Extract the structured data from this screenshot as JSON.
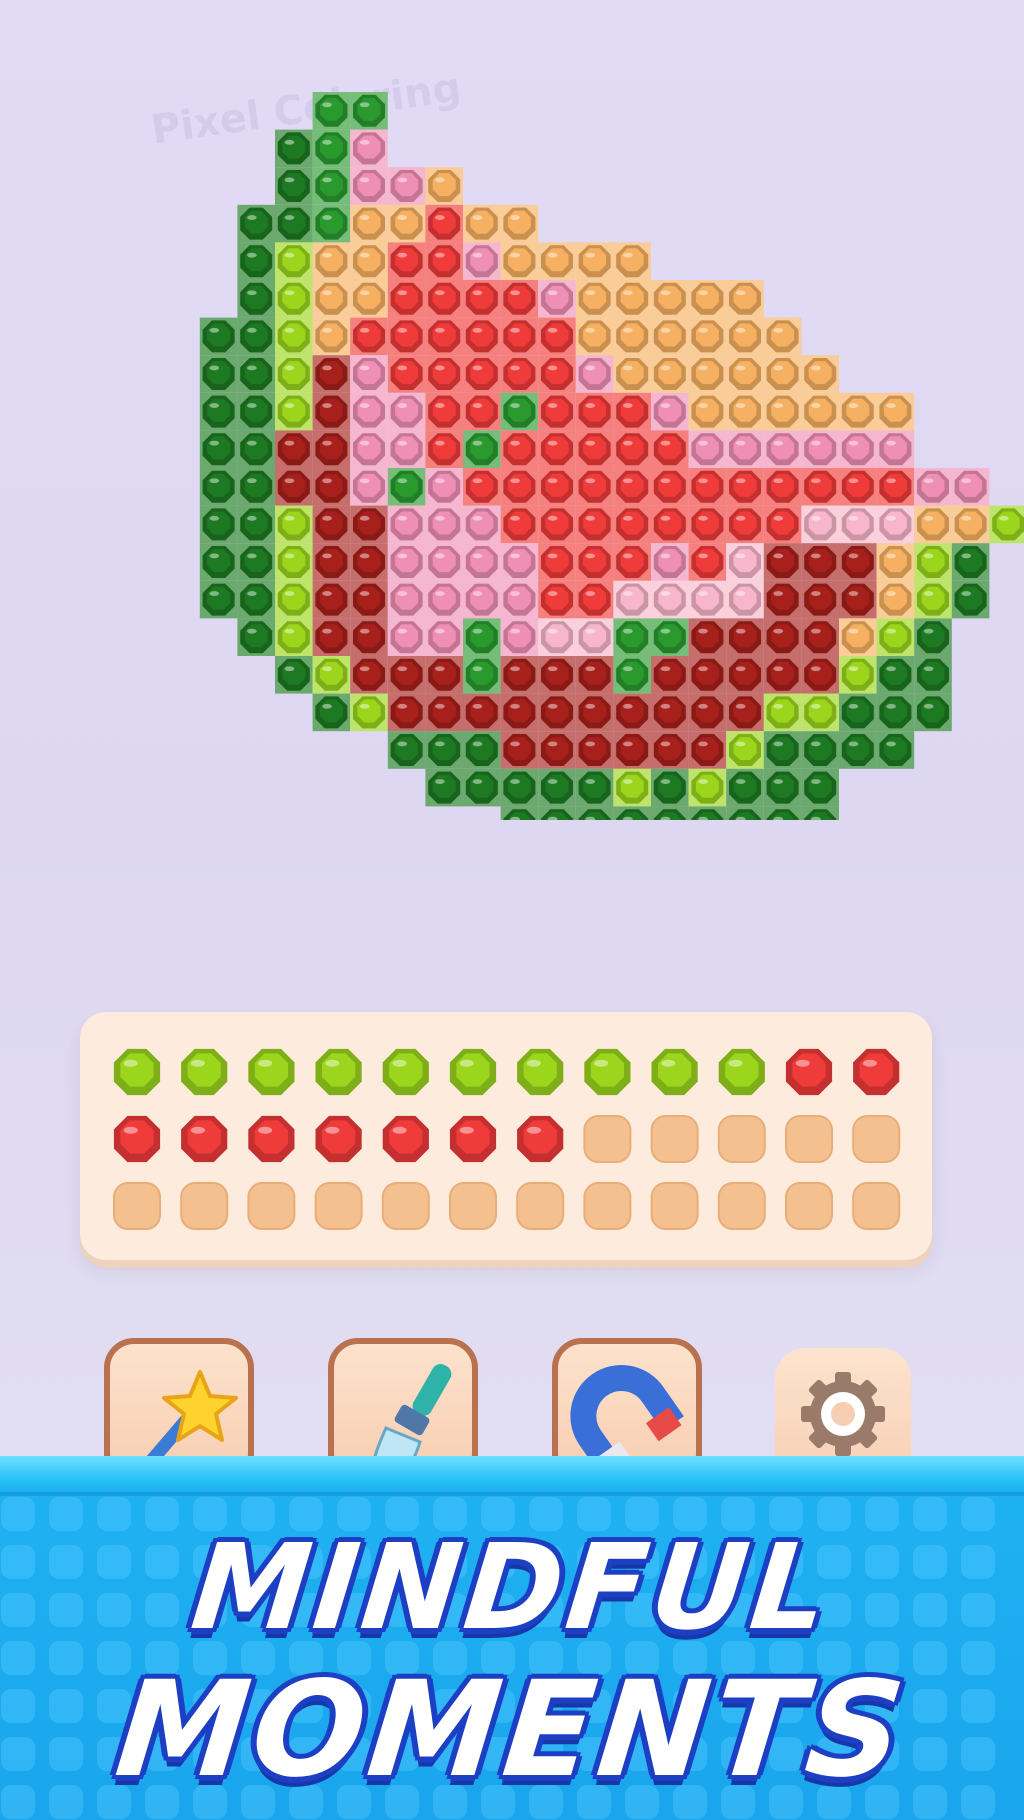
{
  "watermark": "Pixel Coloring",
  "board": {
    "rows": [
      "......kk.................",
      ".....Kkp.................",
      ".....Kkppo...............",
      "....KKkooRoo.............",
      "....KlooRRpoooo..........",
      "....KlooRRRRpooooo.......",
      "...KKloRRRRRRoooooo......",
      "...KKlDpRRRRRpoooooo.....",
      "...KKlDppRRkRRRpoooooo...",
      "...KKDDppRkRRRRRpppppp...",
      "...KKDDpkpRRRRRRRRRRRRpp.",
      "...KKlDDpppRRRRRRRRPPPool",
      "...KKlDDppppRRRpRPDDDolK",
      "...KKlDDppppRRPPPPDDDolK",
      "....KlDDppkpPPkkDDDDolK.",
      ".....KlDDDkDDDkDDDDDlKK.",
      "......KlDDDDDDDDDDllKKK.",
      "........KKKDDDDDDlKKKK..",
      ".........KKKKKlKlKKK....",
      "...........KKKKKKKKK....",
      "........................"
    ],
    "legend": {
      "K": "dark-green",
      "k": "green",
      "l": "lime",
      "p": "pink",
      "P": "light-pink",
      "o": "orange",
      "R": "red",
      "D": "dark-red",
      "n": "navy"
    }
  },
  "tray": {
    "rows": [
      [
        "lime",
        "lime",
        "lime",
        "lime",
        "lime",
        "lime",
        "lime",
        "lime",
        "lime",
        "lime",
        "red",
        "red"
      ],
      [
        "red",
        "red",
        "red",
        "red",
        "red",
        "red",
        "red",
        "empty",
        "empty",
        "empty",
        "empty",
        "empty"
      ],
      [
        "empty",
        "empty",
        "empty",
        "empty",
        "empty",
        "empty",
        "empty",
        "empty",
        "empty",
        "empty",
        "empty",
        "empty"
      ]
    ]
  },
  "tools": [
    {
      "name": "magic-wand",
      "icon": "magic-wand-icon"
    },
    {
      "name": "brush",
      "icon": "brush-icon"
    },
    {
      "name": "magnet",
      "icon": "magnet-icon"
    },
    {
      "name": "settings",
      "icon": "gear-icon"
    }
  ],
  "banner": {
    "line1": "MINDFUL",
    "line2": "MOMENTS"
  },
  "colors": {
    "dark-green": "#1d7a22",
    "green": "#2a9a2f",
    "lime": "#9bd61d",
    "pink": "#f08fb5",
    "light-pink": "#f7b6cb",
    "orange": "#f6b061",
    "red": "#ef3b39",
    "dark-red": "#a8201b",
    "navy": "#2f3e57",
    "empty": "#f4c08f",
    "banner_blue": "#1fb3f2",
    "headline_outline": "#1d3fc4"
  }
}
